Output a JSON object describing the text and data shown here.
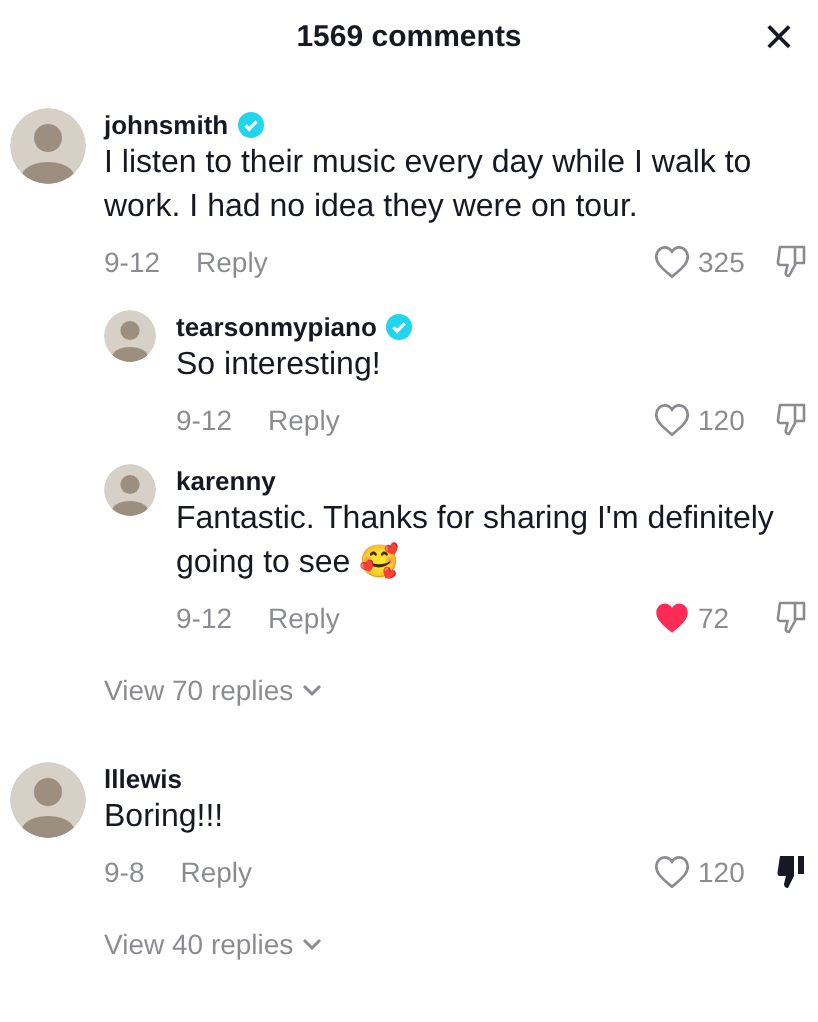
{
  "header": {
    "title": "1569 comments",
    "close": "×"
  },
  "comments": [
    {
      "user": "johnsmith",
      "verified": true,
      "text": "I listen to their music every day while I walk to work. I had no idea they were on tour.",
      "date": "9-12",
      "reply": "Reply",
      "likes": "325",
      "liked": false,
      "disliked": false,
      "children": [
        {
          "user": "tearsonmypiano",
          "verified": true,
          "text": "So interesting!",
          "date": "9-12",
          "reply": "Reply",
          "likes": "120",
          "liked": false,
          "disliked": false
        },
        {
          "user": "karenny",
          "verified": false,
          "text": "Fantastic. Thanks for sharing I'm definitely going to see 🥰",
          "date": "9-12",
          "reply": "Reply",
          "likes": "72",
          "liked": true,
          "disliked": false
        }
      ],
      "view_replies": "View 70 replies"
    },
    {
      "user": "lllewis",
      "verified": false,
      "text": "Boring!!!",
      "date": "9-8",
      "reply": "Reply",
      "likes": "120",
      "liked": false,
      "disliked": true,
      "view_replies": "View 40 replies"
    }
  ]
}
